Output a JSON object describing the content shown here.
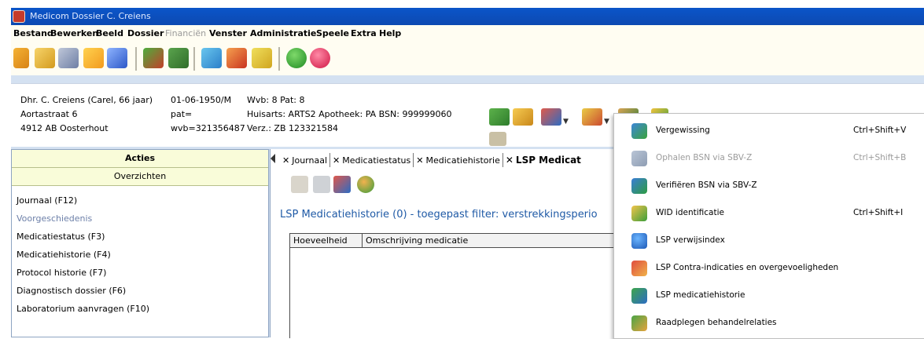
{
  "window": {
    "title": "Medicom  Dossier  C. Creiens"
  },
  "menubar": [
    "Bestand",
    "Bewerken",
    "Beeld",
    "Dossier",
    "Financiën",
    "Venster",
    "Administratie",
    "Speele",
    "Extra",
    "Help"
  ],
  "patient": {
    "name_line": "Dhr. C. Creiens (Carel, 66 jaar)",
    "dob": "01-06-1950/M",
    "wvb_line": "Wvb: 8 Pat: 8",
    "street": "Aortastraat 6",
    "pat": "pat=",
    "huisarts": "Huisarts: ARTS2  Apotheek: PA  BSN: 999999060",
    "city": "4912 AB Oosterhout",
    "wvb2": "wvb=321356487",
    "verz": "Verz.: ZB 123321584"
  },
  "left_panel": {
    "acties": "Acties",
    "overzichten": "Overzichten",
    "items": [
      "Journaal   (F12)",
      "Voorgeschiedenis",
      "Medicatiestatus  (F3)",
      "Medicatiehistorie  (F4)",
      "Protocol historie  (F7)",
      "Diagnostisch dossier  (F6)",
      "Laboratorium aanvragen  (F10)"
    ]
  },
  "tabs": [
    "Journaal",
    "Medicatiestatus",
    "Medicatiehistorie",
    "LSP Medicat"
  ],
  "main": {
    "lsp_title": "LSP Medicatiehistorie (0) - toegepast filter: verstrekkingsperio",
    "columns": [
      "Hoeveelheid",
      "Omschrijving medicatie"
    ]
  },
  "context_menu": [
    {
      "label": "Vergewissing",
      "shortcut": "Ctrl+Shift+V",
      "icon": "vergewissing-icon",
      "disabled": false
    },
    {
      "label": "Ophalen BSN via SBV-Z",
      "shortcut": "Ctrl+Shift+B",
      "icon": "bsn-fetch-icon",
      "disabled": true
    },
    {
      "label": "Verifiëren BSN via SBV-Z",
      "shortcut": "",
      "icon": "bsn-verify-icon",
      "disabled": false
    },
    {
      "label": "WID identificatie",
      "shortcut": "Ctrl+Shift+I",
      "icon": "checkmark-icon",
      "disabled": false
    },
    {
      "label": "LSP verwijsindex",
      "shortcut": "",
      "icon": "lsp-index-icon",
      "disabled": false
    },
    {
      "label": "LSP Contra-indicaties en overgevoeligheden",
      "shortcut": "",
      "icon": "lsp-contra-icon",
      "disabled": false
    },
    {
      "label": "LSP medicatiehistorie",
      "shortcut": "",
      "icon": "lsp-medication-icon",
      "disabled": false
    },
    {
      "label": "Raadplegen behandelrelaties",
      "shortcut": "",
      "icon": "people-icon",
      "disabled": false
    }
  ],
  "colors": {
    "titlebar": "#0b55c9",
    "menubar": "#fffdf2",
    "workspace": "#d4e1f1",
    "accent_blue": "#1f5aa6",
    "panel_header": "#f9fcd9"
  }
}
